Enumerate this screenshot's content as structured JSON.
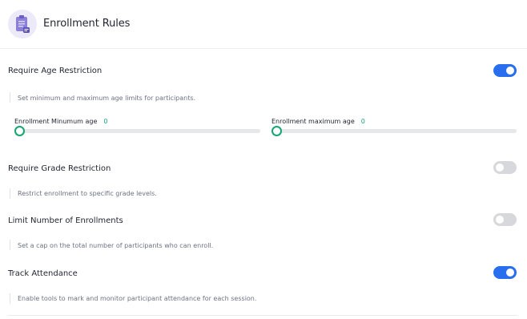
{
  "header": {
    "title": "Enrollment Rules",
    "icon": "clipboard-icon",
    "icon_color": "#8b7fd8"
  },
  "age_restriction": {
    "title": "Require Age Restriction",
    "description": "Set minimum and maximum age limits for participants.",
    "enabled": true,
    "min_slider": {
      "label": "Enrollment Minumum age",
      "value": "0"
    },
    "max_slider": {
      "label": "Enrollment maximum age",
      "value": "0"
    }
  },
  "grade_restriction": {
    "title": "Require Grade Restriction",
    "description": "Restrict enrollment to specific grade levels.",
    "enabled": false
  },
  "limit_enrollments": {
    "title": "Limit Number of Enrollments",
    "description": "Set a cap on the total number of participants who can enroll.",
    "enabled": false
  },
  "track_attendance": {
    "title": "Track Attendance",
    "description": "Enable tools to mark and monitor participant attendance for each session.",
    "enabled": true
  },
  "colors": {
    "toggle_on": "#2a6ef0",
    "toggle_off": "#d6d8dc",
    "slider_accent": "#13a66f",
    "value_text": "#1aa37a"
  }
}
